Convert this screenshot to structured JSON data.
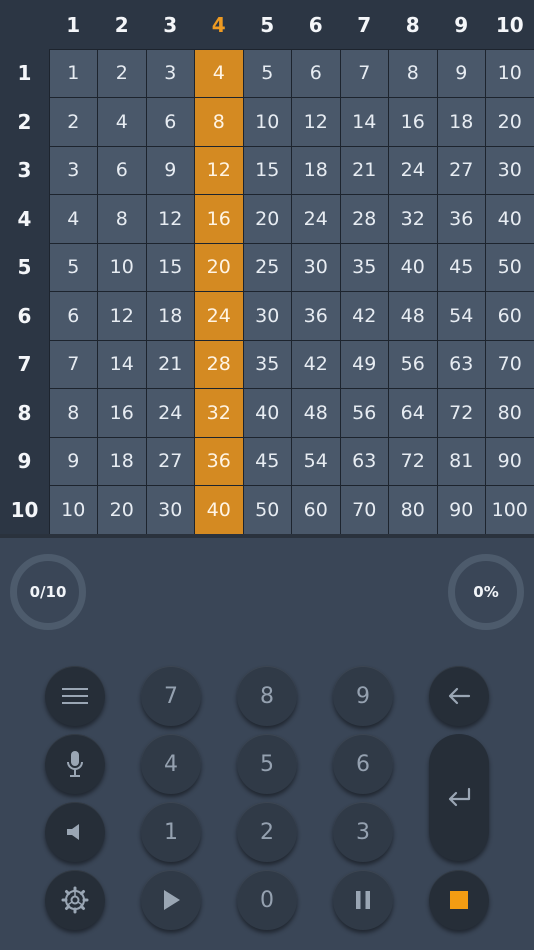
{
  "table": {
    "columns": [
      "1",
      "2",
      "3",
      "4",
      "5",
      "6",
      "7",
      "8",
      "9",
      "10"
    ],
    "rows": [
      "1",
      "2",
      "3",
      "4",
      "5",
      "6",
      "7",
      "8",
      "9",
      "10"
    ],
    "active_column_index": 3,
    "cells": [
      [
        "1",
        "2",
        "3",
        "4",
        "5",
        "6",
        "7",
        "8",
        "9",
        "10"
      ],
      [
        "2",
        "4",
        "6",
        "8",
        "10",
        "12",
        "14",
        "16",
        "18",
        "20"
      ],
      [
        "3",
        "6",
        "9",
        "12",
        "15",
        "18",
        "21",
        "24",
        "27",
        "30"
      ],
      [
        "4",
        "8",
        "12",
        "16",
        "20",
        "24",
        "28",
        "32",
        "36",
        "40"
      ],
      [
        "5",
        "10",
        "15",
        "20",
        "25",
        "30",
        "35",
        "40",
        "45",
        "50"
      ],
      [
        "6",
        "12",
        "18",
        "24",
        "30",
        "36",
        "42",
        "48",
        "54",
        "60"
      ],
      [
        "7",
        "14",
        "21",
        "28",
        "35",
        "42",
        "49",
        "56",
        "63",
        "70"
      ],
      [
        "8",
        "16",
        "24",
        "32",
        "40",
        "48",
        "56",
        "64",
        "72",
        "80"
      ],
      [
        "9",
        "18",
        "27",
        "36",
        "45",
        "54",
        "63",
        "72",
        "81",
        "90"
      ],
      [
        "10",
        "20",
        "30",
        "40",
        "50",
        "60",
        "70",
        "80",
        "90",
        "100"
      ]
    ]
  },
  "progress": {
    "score_label": "0/10",
    "percent_label": "0%"
  },
  "keypad": {
    "digits": {
      "seven": "7",
      "eight": "8",
      "nine": "9",
      "four": "4",
      "five": "5",
      "six": "6",
      "one": "1",
      "two": "2",
      "three": "3",
      "zero": "0"
    },
    "icons": {
      "menu": "menu-icon",
      "microphone": "microphone-icon",
      "speaker": "speaker-icon",
      "settings": "gear-icon",
      "play": "play-icon",
      "pause": "pause-icon",
      "stop": "stop-icon",
      "backspace": "backspace-arrow-icon",
      "enter": "return-icon"
    }
  },
  "colors": {
    "accent": "#ef9b22",
    "highlight_column": "#d48a22",
    "cell": "#4a586a",
    "header_background": "#2c3644",
    "background": "#3a4657"
  }
}
